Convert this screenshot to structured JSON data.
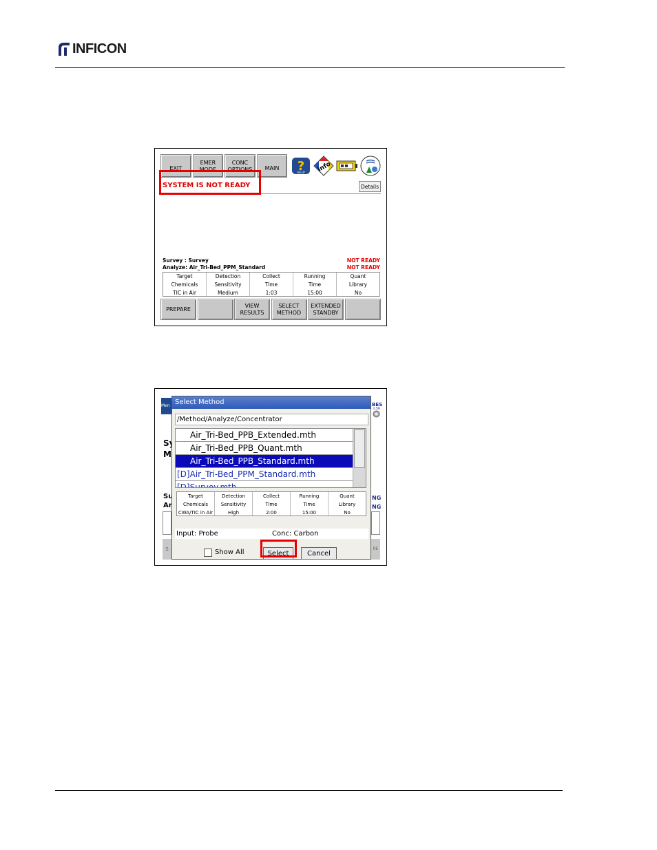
{
  "logo": {
    "text": "INFICON"
  },
  "screen1": {
    "top_buttons": [
      {
        "line1": "EXIT",
        "line2": ""
      },
      {
        "line1": "EMER",
        "line2": "MODE"
      },
      {
        "line1": "CONC",
        "line2": "OPTIONS"
      },
      {
        "line1": "MAIN",
        "line2": ""
      }
    ],
    "icons": [
      "help-icon",
      "info-icon",
      "battery-icon",
      "environment-icon"
    ],
    "status": "SYSTEM IS NOT READY",
    "details_label": "Details",
    "survey_line": "Survey  : Survey",
    "analyze_line": "Analyze: Air_Tri-Bed_PPM_Standard",
    "survey_status": "NOT READY",
    "analyze_status": "NOT READY",
    "params": [
      {
        "h1": "Target",
        "h2": "Chemicals",
        "value": "TIC in Air"
      },
      {
        "h1": "Detection",
        "h2": "Sensitivity",
        "value": "Medium"
      },
      {
        "h1": "Collect",
        "h2": "Time",
        "value": "1:03"
      },
      {
        "h1": "Running",
        "h2": "Time",
        "value": "15:00"
      },
      {
        "h1": "Quant",
        "h2": "Library",
        "value": "No"
      }
    ],
    "bottom_buttons": [
      {
        "line1": "PREPARE",
        "line2": ""
      },
      {
        "line1": "",
        "line2": ""
      },
      {
        "line1": "VIEW",
        "line2": "RESULTS"
      },
      {
        "line1": "SELECT",
        "line2": "METHOD"
      },
      {
        "line1": "EXTENDED",
        "line2": "STANDBY"
      },
      {
        "line1": "",
        "line2": ""
      }
    ]
  },
  "screen2": {
    "bg_left_top": "Men",
    "bg_left_letters": [
      "Sy",
      "M",
      "Su",
      "Ar"
    ],
    "bg_right_top": "BES",
    "bg_right_small": "0.5M",
    "bg_right_ng": [
      "NG",
      "NG"
    ],
    "bg_right_bottom": "RE",
    "bg_left_bottom": "S",
    "dialog_title": "Select Method",
    "path": "/Method/Analyze/Concentrator",
    "files": [
      {
        "name": "Air_Tri-Bed_PPB_Extended.mth",
        "style": "indent"
      },
      {
        "name": "Air_Tri-Bed_PPB_Quant.mth",
        "style": "indent"
      },
      {
        "name": "Air_Tri-Bed_PPB_Standard.mth",
        "style": "indent sel"
      },
      {
        "name": "[D]Air_Tri-Bed_PPM_Standard.mth",
        "style": "d"
      },
      {
        "name": "[D]Survey.mth",
        "style": "d"
      }
    ],
    "params": [
      {
        "h1": "Target",
        "h2": "Chemicals",
        "value": "CWA/TIC in Air"
      },
      {
        "h1": "Detection",
        "h2": "Sensitivity",
        "value": "High"
      },
      {
        "h1": "Collect",
        "h2": "Time",
        "value": "2:00"
      },
      {
        "h1": "Running",
        "h2": "Time",
        "value": "15:00"
      },
      {
        "h1": "Quant",
        "h2": "Library",
        "value": "No"
      }
    ],
    "input_label": "Input: Probe",
    "conc_label": "Conc: Carbon",
    "show_all_label": "Show All",
    "select_label": "Select",
    "cancel_label": "Cancel"
  },
  "colors": {
    "highlight_red": "#e60000",
    "selected_blue": "#0a0ab8",
    "title_blue": "#2f5bb8"
  }
}
